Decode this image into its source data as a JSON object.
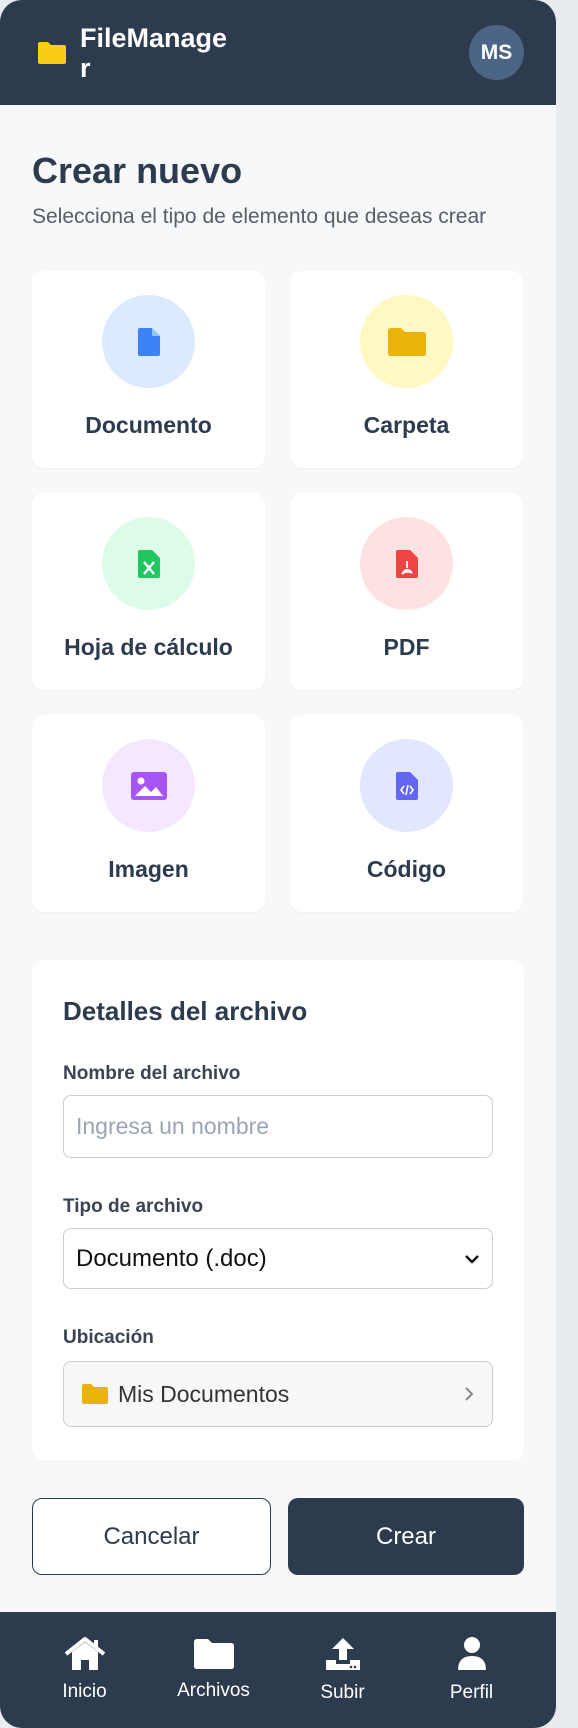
{
  "header": {
    "app_name": "FileManager",
    "avatar_initials": "MS"
  },
  "page": {
    "title": "Crear nuevo",
    "subtitle": "Selecciona el tipo de elemento que deseas crear"
  },
  "types": [
    {
      "label": "Documento",
      "icon": "document-icon",
      "bg": "#dbeafe",
      "color": "#3b82f6"
    },
    {
      "label": "Carpeta",
      "icon": "folder-icon",
      "bg": "#fef9c3",
      "color": "#eab308"
    },
    {
      "label": "Hoja de cálculo",
      "icon": "spreadsheet-icon",
      "bg": "#dcfce7",
      "color": "#22c55e"
    },
    {
      "label": "PDF",
      "icon": "pdf-icon",
      "bg": "#fee2e2",
      "color": "#ef4444"
    },
    {
      "label": "Imagen",
      "icon": "image-icon",
      "bg": "#f3e8ff",
      "color": "#a855f7"
    },
    {
      "label": "Código",
      "icon": "code-icon",
      "bg": "#e0e7ff",
      "color": "#6366f1"
    }
  ],
  "details": {
    "title": "Detalles del archivo",
    "name_label": "Nombre del archivo",
    "name_placeholder": "Ingresa un nombre",
    "type_label": "Tipo de archivo",
    "type_value": "Documento (.doc)",
    "location_label": "Ubicación",
    "location_value": "Mis Documentos"
  },
  "actions": {
    "cancel": "Cancelar",
    "create": "Crear"
  },
  "nav": [
    {
      "label": "Inicio",
      "icon": "home-icon"
    },
    {
      "label": "Archivos",
      "icon": "folder-icon"
    },
    {
      "label": "Subir",
      "icon": "upload-icon"
    },
    {
      "label": "Perfil",
      "icon": "user-icon"
    }
  ],
  "colors": {
    "primary": "#2d3b4e",
    "accent_folder": "#facc15"
  }
}
